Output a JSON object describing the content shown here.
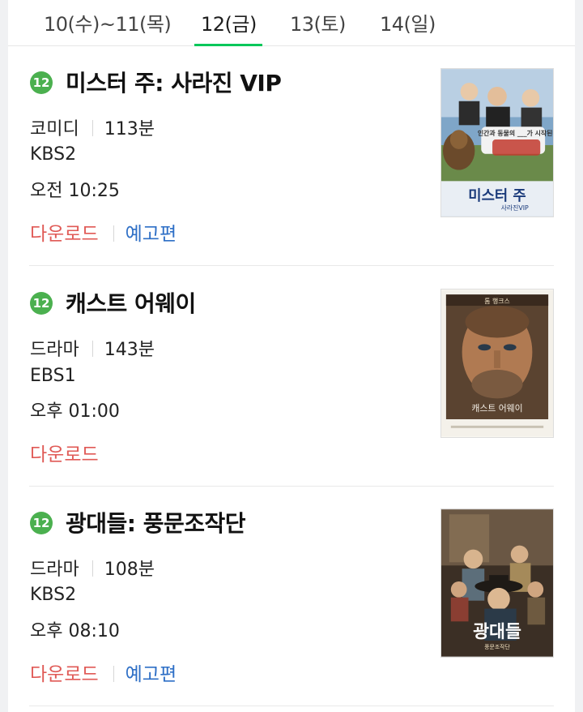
{
  "tabs": [
    {
      "label": "10(수)~11(목)",
      "active": false
    },
    {
      "label": "12(금)",
      "active": true
    },
    {
      "label": "13(토)",
      "active": false
    },
    {
      "label": "14(일)",
      "active": false
    }
  ],
  "colors": {
    "accent": "#03c75a",
    "age_badge": "#4bb04f",
    "download": "#e05a56",
    "trailer": "#2e6fc6"
  },
  "movies": [
    {
      "age_rating": "12",
      "title": "미스터 주: 사라진 VIP",
      "genre": "코미디",
      "runtime": "113분",
      "channel": "KBS2",
      "time": "오전 10:25",
      "download_label": "다운로드",
      "trailer_label": "예고편",
      "poster": {
        "caption_top": "인간과 동물의 ___가 시작된다!",
        "title": "미스터 주",
        "subtitle": "사라진VIP"
      }
    },
    {
      "age_rating": "12",
      "title": "캐스트 어웨이",
      "genre": "드라마",
      "runtime": "143분",
      "channel": "EBS1",
      "time": "오후 01:00",
      "download_label": "다운로드",
      "poster": {
        "caption_top": "톰 행크스",
        "title": "캐스트 어웨이"
      }
    },
    {
      "age_rating": "12",
      "title": "광대들: 풍문조작단",
      "genre": "드라마",
      "runtime": "108분",
      "channel": "KBS2",
      "time": "오후 08:10",
      "download_label": "다운로드",
      "trailer_label": "예고편",
      "poster": {
        "title": "광대들",
        "subtitle": "풍문조작단"
      }
    }
  ]
}
